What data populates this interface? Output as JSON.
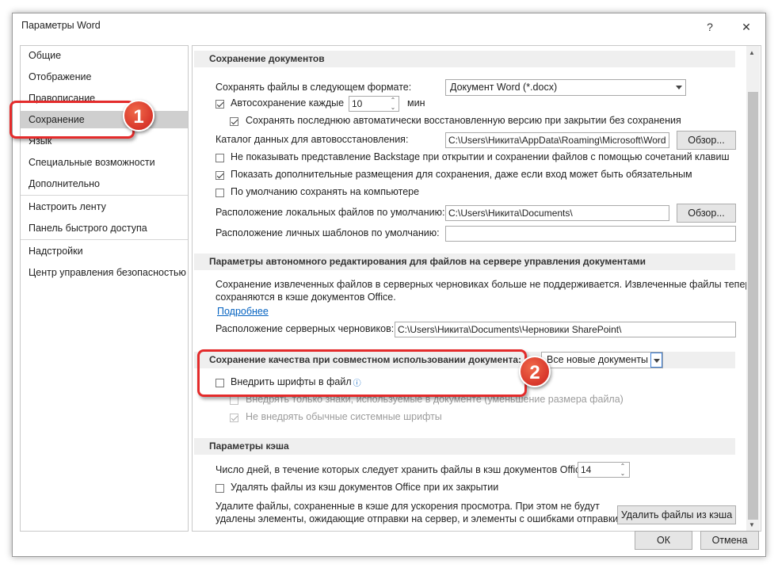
{
  "window": {
    "title": "Параметры Word",
    "help": "?",
    "close": "✕"
  },
  "nav": {
    "items": [
      {
        "label": "Общие"
      },
      {
        "label": "Отображение"
      },
      {
        "label": "Правописание"
      },
      {
        "label": "Сохранение",
        "selected": true
      },
      {
        "label": "Язык"
      },
      {
        "label": "Специальные возможности"
      },
      {
        "label": "Дополнительно"
      },
      {
        "label": "Настроить ленту"
      },
      {
        "label": "Панель быстрого доступа"
      },
      {
        "label": "Надстройки"
      },
      {
        "label": "Центр управления безопасностью"
      }
    ]
  },
  "save_docs": {
    "header": "Сохранение документов",
    "format_label": "Сохранять файлы в следующем формате:",
    "format_value": "Документ Word (*.docx)",
    "autosave_label": "Автосохранение каждые",
    "autosave_value": "10",
    "autosave_unit": "мин",
    "keep_last_label": "Сохранять последнюю автоматически восстановленную версию при закрытии без сохранения",
    "autorecover_label": "Каталог данных для автовосстановления:",
    "autorecover_value": "C:\\Users\\Никита\\AppData\\Roaming\\Microsoft\\Word",
    "browse1": "Обзор...",
    "no_backstage_label": "Не показывать представление Backstage при открытии и сохранении файлов с помощью сочетаний клавиш",
    "show_additional_label": "Показать дополнительные размещения для сохранения, даже если вход может быть обязательным",
    "save_computer_label": "По умолчанию сохранять на компьютере",
    "local_location_label": "Расположение локальных файлов по умолчанию:",
    "local_location_value": "C:\\Users\\Никита\\Documents\\",
    "browse2": "Обзор...",
    "templates_label": "Расположение личных шаблонов по умолчанию:",
    "templates_value": ""
  },
  "offline": {
    "header": "Параметры автономного редактирования для файлов на сервере управления документами",
    "text1": "Сохранение извлеченных файлов в серверных черновиках больше не поддерживается. Извлеченные файлы теперь",
    "text2": "сохраняются в кэше документов Office.",
    "more_link": "Подробнее",
    "drafts_label": "Расположение серверных черновиков:",
    "drafts_value": "C:\\Users\\Никита\\Documents\\Черновики SharePoint\\"
  },
  "fidelity": {
    "header": "Сохранение качества при совместном использовании документа:",
    "doc_value": "Все новые документы",
    "embed_fonts_label": "Внедрить шрифты в файл",
    "embed_chars_label": "Внедрять только знаки, используемые в документе (уменьшение размера файла)",
    "no_system_fonts_label": "Не внедрять обычные системные шрифты"
  },
  "cache": {
    "header": "Параметры кэша",
    "days_label": "Число дней, в течение которых следует хранить файлы в кэш документов Office:",
    "days_value": "14",
    "delete_on_close_label": "Удалять файлы из кэш документов Office при их закрытии",
    "info1": "Удалите файлы, сохраненные в кэше для ускорения просмотра. При этом не будут",
    "info2": "удалены элементы, ожидающие отправки на сервер, и элементы с ошибками отправки.",
    "delete_button": "Удалить файлы из кэша"
  },
  "footer": {
    "ok": "ОК",
    "cancel": "Отмена"
  },
  "annotations": {
    "badge1": "1",
    "badge2": "2",
    "color": "#e42b2b"
  }
}
